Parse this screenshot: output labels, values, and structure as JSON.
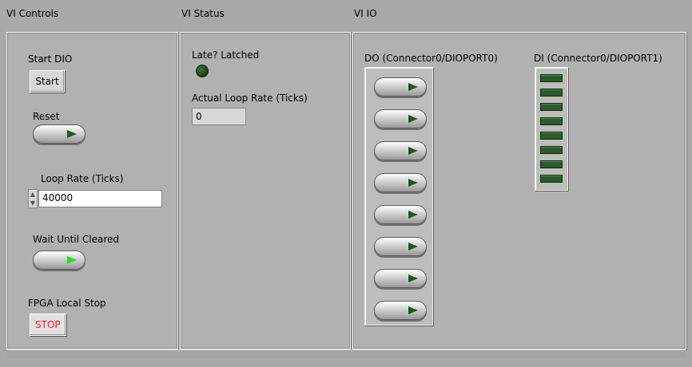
{
  "sections": {
    "controls_title": "VI Controls",
    "status_title": "VI Status",
    "io_title": "VI IO"
  },
  "controls": {
    "start_dio_label": "Start DIO",
    "start_button": "Start",
    "reset_label": "Reset",
    "reset_state": "off",
    "loop_rate_label": "Loop Rate (Ticks)",
    "loop_rate_value": "40000",
    "wait_until_cleared_label": "Wait Until Cleared",
    "wait_until_cleared_state": "on",
    "fpga_stop_label": "FPGA Local Stop",
    "stop_button": "STOP"
  },
  "status": {
    "late_latched_label": "Late? Latched",
    "late_latched_state": "off",
    "actual_loop_rate_label": "Actual Loop Rate (Ticks)",
    "actual_loop_rate_value": "0"
  },
  "io": {
    "do_label": "DO (Connector0/DIOPORT0)",
    "do_count": 8,
    "di_label": "DI (Connector0/DIOPORT1)",
    "di_count": 8
  },
  "colors": {
    "panel_bg": "#b1b1b1",
    "led_off": "#1f5a1f",
    "led_on": "#25e025",
    "stop_text": "#ff1a1a"
  }
}
